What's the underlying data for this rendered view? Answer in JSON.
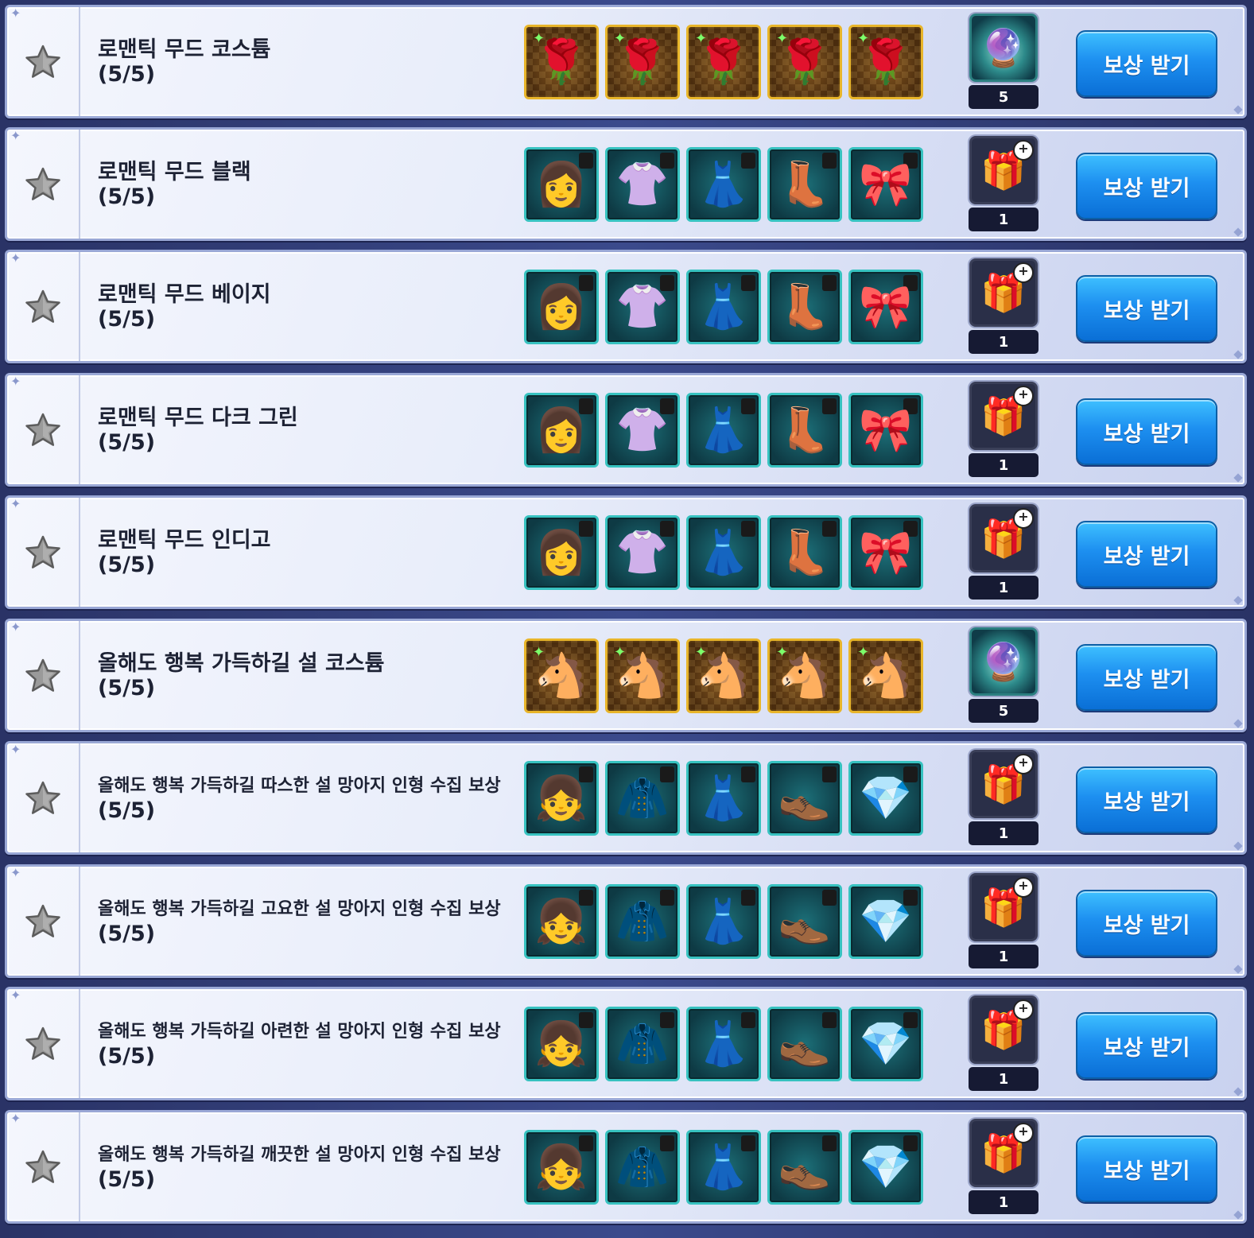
{
  "colors": {
    "accent": "#1d8ff0",
    "panel": "#e8edfa",
    "gold_frame": "#e8b52a",
    "teal_frame": "#37c2c0"
  },
  "claim_label": "보상 받기",
  "rows": [
    {
      "title": "로맨틱 무드 코스튬",
      "progress": "(5/5)",
      "item_style": "gold",
      "items": [
        "rose-corsage-red-icon",
        "rose-corsage-blue-icon",
        "rose-corsage-white-icon",
        "rose-corsage-purple-icon",
        "rose-corsage-pink-icon"
      ],
      "item_glyphs": [
        "🌹",
        "🌹",
        "🌹",
        "🌹",
        "🌹"
      ],
      "reward_icon": "crystal-orb-icon",
      "reward_glyph": "🔮",
      "reward_qty": "5"
    },
    {
      "title": "로맨틱 무드 블랙",
      "progress": "(5/5)",
      "item_style": "teal",
      "items": [
        "hair-black-icon",
        "top-black-icon",
        "skirt-black-icon",
        "shoes-black-icon",
        "headband-black-icon"
      ],
      "item_glyphs": [
        "👩",
        "👚",
        "👗",
        "👢",
        "🎀"
      ],
      "reward_icon": "gift-box-icon",
      "reward_glyph": "🎁",
      "reward_qty": "1"
    },
    {
      "title": "로맨틱 무드 베이지",
      "progress": "(5/5)",
      "item_style": "teal",
      "items": [
        "hair-red-icon",
        "top-beige-icon",
        "skirt-beige-icon",
        "shoes-beige-icon",
        "headband-black-icon"
      ],
      "item_glyphs": [
        "👩",
        "👚",
        "👗",
        "👢",
        "🎀"
      ],
      "reward_icon": "gift-box-icon",
      "reward_glyph": "🎁",
      "reward_qty": "1"
    },
    {
      "title": "로맨틱 무드 다크 그린",
      "progress": "(5/5)",
      "item_style": "teal",
      "items": [
        "hair-gray-icon",
        "top-dark-green-icon",
        "skirt-dark-green-icon",
        "shoes-pink-icon",
        "headband-black-icon"
      ],
      "item_glyphs": [
        "👩",
        "👚",
        "👗",
        "👢",
        "🎀"
      ],
      "reward_icon": "gift-box-icon",
      "reward_glyph": "🎁",
      "reward_qty": "1"
    },
    {
      "title": "로맨틱 무드 인디고",
      "progress": "(5/5)",
      "item_style": "teal",
      "items": [
        "hair-white-icon",
        "top-indigo-icon",
        "skirt-indigo-icon",
        "shoes-white-icon",
        "headband-black-icon"
      ],
      "item_glyphs": [
        "👩",
        "👚",
        "👗",
        "👢",
        "🎀"
      ],
      "reward_icon": "gift-box-icon",
      "reward_glyph": "🎁",
      "reward_qty": "1"
    },
    {
      "title": "올해도 행복 가득하길 설 코스튬",
      "progress": "(5/5)",
      "item_style": "gold",
      "items": [
        "pony-doll-red-icon",
        "pony-doll-pink-icon",
        "pony-doll-brown-icon",
        "pony-doll-blue-icon",
        "pony-doll-black-icon"
      ],
      "item_glyphs": [
        "🐴",
        "🐴",
        "🐴",
        "🐴",
        "🐴"
      ],
      "reward_icon": "crystal-orb-icon",
      "reward_glyph": "🔮",
      "reward_qty": "5"
    },
    {
      "title": "올해도 행복 가득하길 따스한 설 망아지 인형 수집 보상",
      "progress": "(5/5)",
      "item_style": "teal",
      "items": [
        "hair-black-pigtails-icon",
        "coat-black-icon",
        "skirt-gray-icon",
        "shoes-black-icon",
        "earrings-gold-icon"
      ],
      "item_glyphs": [
        "👧",
        "🧥",
        "👗",
        "👞",
        "💎"
      ],
      "reward_icon": "gift-box-icon",
      "reward_glyph": "🎁",
      "reward_qty": "1"
    },
    {
      "title": "올해도 행복 가득하길 고요한 설 망아지 인형 수집 보상",
      "progress": "(5/5)",
      "item_style": "teal",
      "items": [
        "hair-brown-pigtails-icon",
        "coat-peach-icon",
        "skirt-blue-icon",
        "shoes-silver-icon",
        "earrings-gold-icon"
      ],
      "item_glyphs": [
        "👧",
        "🧥",
        "👗",
        "👞",
        "💎"
      ],
      "reward_icon": "gift-box-icon",
      "reward_glyph": "🎁",
      "reward_qty": "1"
    },
    {
      "title": "올해도 행복 가득하길 아련한 설 망아지 인형 수집 보상",
      "progress": "(5/5)",
      "item_style": "teal",
      "items": [
        "hair-blonde-pigtails-icon",
        "coat-blue-icon",
        "skirt-brown-icon",
        "shoes-tan-icon",
        "earrings-gold-icon"
      ],
      "item_glyphs": [
        "👧",
        "🧥",
        "👗",
        "👞",
        "💎"
      ],
      "reward_icon": "gift-box-icon",
      "reward_glyph": "🎁",
      "reward_qty": "1"
    },
    {
      "title": "올해도 행복 가득하길 깨끗한 설 망아지 인형 수집 보상",
      "progress": "(5/5)",
      "item_style": "teal",
      "items": [
        "hair-silver-pigtails-icon",
        "coat-pink-icon",
        "skirt-magenta-icon",
        "shoes-pink-icon",
        "earrings-gold-icon"
      ],
      "item_glyphs": [
        "👧",
        "🧥",
        "👗",
        "👞",
        "💎"
      ],
      "reward_icon": "gift-box-icon",
      "reward_glyph": "🎁",
      "reward_qty": "1"
    }
  ]
}
